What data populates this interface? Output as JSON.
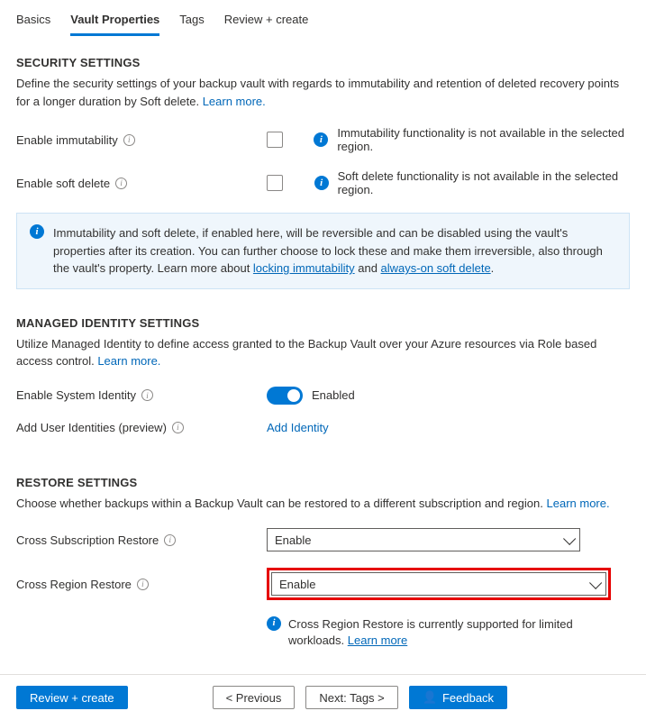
{
  "tabs": {
    "basics": "Basics",
    "vault": "Vault Properties",
    "tags": "Tags",
    "review": "Review + create"
  },
  "security": {
    "title": "SECURITY SETTINGS",
    "desc": "Define the security settings of your backup vault with regards to immutability and retention of deleted recovery points for a longer duration by Soft delete. ",
    "learn": "Learn more.",
    "immutability_label": "Enable immutability",
    "immutability_msg": "Immutability functionality is not available in the selected region.",
    "softdelete_label": "Enable soft delete",
    "softdelete_msg": "Soft delete functionality is not available in the selected region.",
    "banner_pre": "Immutability and soft delete, if enabled here, will be reversible and can be disabled using the vault's properties after its creation. You can further choose to lock these and make them irreversible, also through the vault's property. Learn more about ",
    "banner_link1": "locking immutability",
    "banner_mid": " and ",
    "banner_link2": "always-on soft delete",
    "banner_post": "."
  },
  "identity": {
    "title": "MANAGED IDENTITY SETTINGS",
    "desc": "Utilize Managed Identity to define access granted to the Backup Vault over your Azure resources via Role based access control. ",
    "learn": "Learn more.",
    "system_label": "Enable System Identity",
    "system_state": "Enabled",
    "user_label": "Add User Identities (preview)",
    "add_link": "Add Identity"
  },
  "restore": {
    "title": "RESTORE SETTINGS",
    "desc": "Choose whether backups within a Backup Vault can be restored to a different subscription and region. ",
    "learn": "Learn more.",
    "csr_label": "Cross Subscription Restore",
    "csr_value": "Enable",
    "crr_label": "Cross Region Restore",
    "crr_value": "Enable",
    "crr_note_pre": "Cross Region Restore is currently supported for limited workloads. ",
    "crr_note_link": "Learn more"
  },
  "footer": {
    "review": "Review + create",
    "previous": "< Previous",
    "next": "Next: Tags >",
    "feedback": "Feedback"
  }
}
